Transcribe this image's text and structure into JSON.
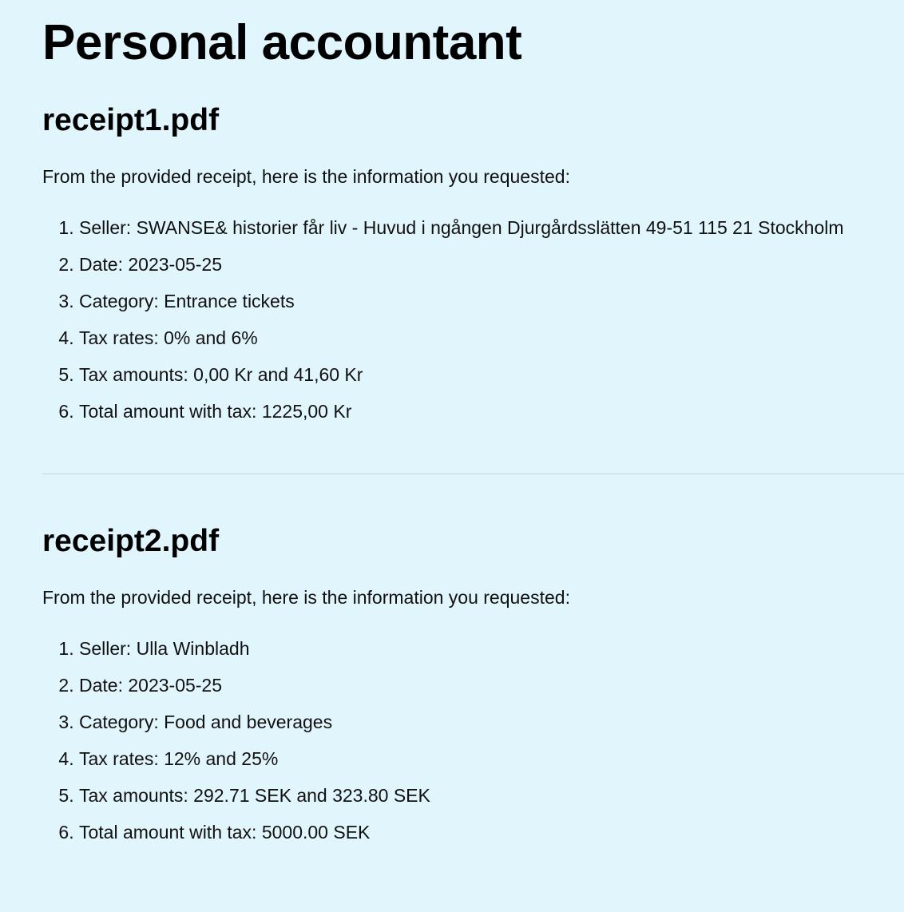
{
  "page": {
    "title": "Personal accountant"
  },
  "receipts": [
    {
      "filename": "receipt1.pdf",
      "intro": "From the provided receipt, here is the information you requested:",
      "items": [
        "Seller: SWANSE& historier får liv - Huvud i ngången Djurgårdsslätten 49-51 115 21 Stockholm",
        "Date: 2023-05-25",
        "Category: Entrance tickets",
        "Tax rates: 0% and 6%",
        "Tax amounts: 0,00 Kr and 41,60 Kr",
        "Total amount with tax: 1225,00 Kr"
      ]
    },
    {
      "filename": "receipt2.pdf",
      "intro": "From the provided receipt, here is the information you requested:",
      "items": [
        "Seller: Ulla Winbladh",
        "Date: 2023-05-25",
        "Category: Food and beverages",
        "Tax rates: 12% and 25%",
        "Tax amounts: 292.71 SEK and 323.80 SEK",
        "Total amount with tax: 5000.00 SEK"
      ]
    }
  ]
}
